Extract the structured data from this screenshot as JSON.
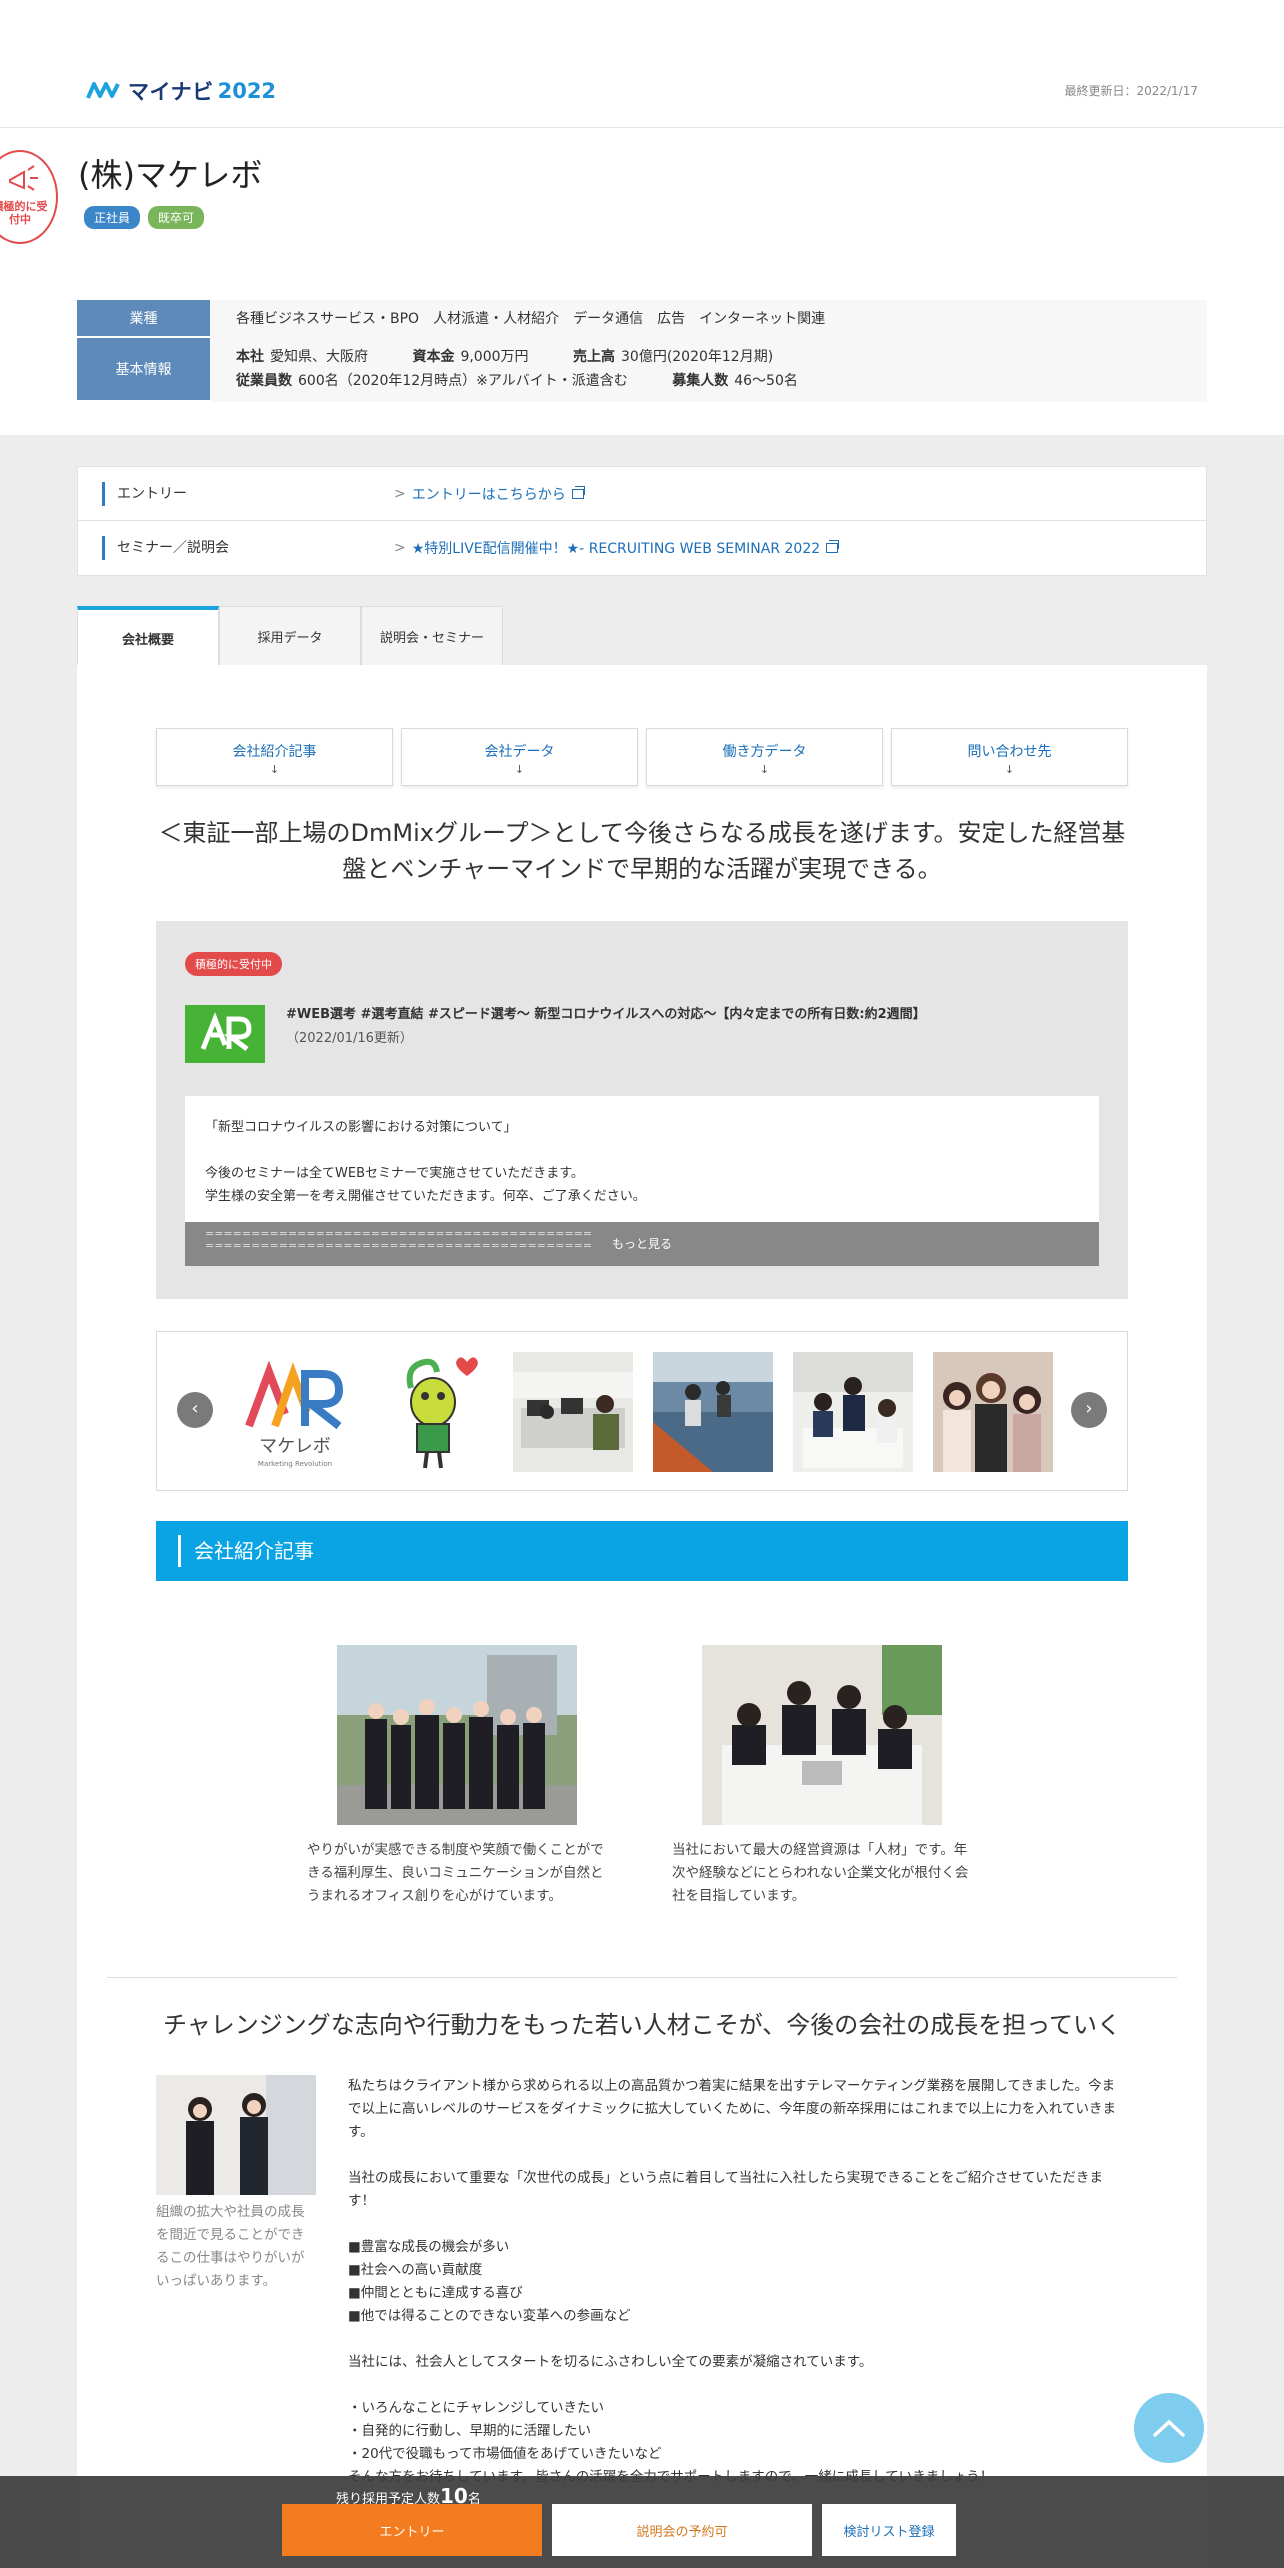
{
  "header": {
    "brand": "マイナビ",
    "year": "2022",
    "updated": "最終更新日：2022/1/17"
  },
  "company": {
    "stamp": "積極的に受付中",
    "name": "(株)マケレボ",
    "tags": [
      "正社員",
      "既卒可"
    ]
  },
  "info": {
    "industry_label": "業種",
    "industries": "各種ビジネスサービス・BPO　人材派遣・人材紹介　データ通信　広告　インターネット関連",
    "basic_label": "基本情報",
    "hq_label": "本社",
    "hq": "愛知県、大阪府",
    "capital_label": "資本金",
    "capital": "9,000万円",
    "sales_label": "売上高",
    "sales": "30億円(2020年12月期)",
    "employees_label": "従業員数",
    "employees": "600名（2020年12月時点）※アルバイト・派遣含む",
    "recruit_label": "募集人数",
    "recruit": "46～50名"
  },
  "links": {
    "entry_label": "エントリー",
    "entry_link": "エントリーはこちらから",
    "seminar_label": "セミナー／説明会",
    "seminar_link": "★特別LIVE配信開催中！★- RECRUITING WEB SEMINAR 2022"
  },
  "tabs": [
    "会社概要",
    "採用データ",
    "説明会・セミナー"
  ],
  "subnav": [
    "会社紹介記事",
    "会社データ",
    "働き方データ",
    "問い合わせ先"
  ],
  "subnav_arrow": "↓",
  "catch": "＜東証一部上場のDmMixグループ＞として今後さらなる成長を遂げます。安定した経営基盤とベンチャーマインドで早期的な活躍が実現できる。",
  "notice": {
    "badge": "積極的に受付中",
    "title": "#WEB選考 #選考直結 #スピード選考～ 新型コロナウイルスへの対応～【内々定までの所有日数:約2週間】",
    "updated": "（2022/01/16更新）",
    "line1": "「新型コロナウイルスの影響における対策について」",
    "line2": "今後のセミナーは全てWEBセミナーで実施させていただきます。",
    "line3": "学生様の安全第一を考え開催させていただきます。何卒、ご了承ください。",
    "eq1": "==========================================",
    "eq2": "==========================================",
    "more": "もっと見る"
  },
  "carousel": {
    "prev": "‹",
    "next": "›",
    "logo_text": "マケレボ",
    "logo_sub": "Marketing Revolution"
  },
  "section_title": "会社紹介記事",
  "articles": [
    {
      "caption": "やりがいが実感できる制度や笑顔で働くことができる福利厚生、良いコミュニケーションが自然とうまれるオフィス創りを心がけています。"
    },
    {
      "caption": "当社において最大の経営資源は「人材」です。年次や経験などにとらわれない企業文化が根付く会社を目指しています。"
    }
  ],
  "head2": "チャレンジングな志向や行動力をもった若い人材こそが、今後の会社の成長を担っていく",
  "side_caption": "組織の拡大や社員の成長を間近で見ることができるこの仕事はやりがいがいっぱいあります。",
  "body": {
    "p1": "私たちはクライアント様から求められる以上の高品質かつ着実に結果を出すテレマーケティング業務を展開してきました。今まで以上に高いレベルのサービスをダイナミックに拡大していくために、今年度の新卒採用にはこれまで以上に力を入れていきます。",
    "p2": "当社の成長において重要な「次世代の成長」という点に着目して当社に入社したら実現できることをご紹介させていただきます！",
    "l1": "■豊富な成長の機会が多い",
    "l2": "■社会への高い貢献度",
    "l3": "■仲間とともに達成する喜び",
    "l4": "■他では得ることのできない変革への参画など",
    "p3": "当社には、社会人としてスタートを切るにふさわしい全ての要素が凝縮されています。",
    "b1": "・いろんなことにチャレンジしていきたい",
    "b2": "・自発的に行動し、早期的に活躍したい",
    "b3": "・20代で役職もって市場価値をあげていきたいなど",
    "p4": "そんな方をお待ちしています。皆さんの活躍を全力でサポートしますので、一緒に成長していきましょう！"
  },
  "footer": {
    "count_prefix": "残り採用予定人数",
    "count": "10",
    "count_suffix": "名",
    "entry": "エントリー",
    "seminar": "説明会の予約可",
    "list": "検討リスト登録"
  },
  "colors": {
    "accent": "#0aa3e3",
    "label_bg": "#5d8ab8",
    "entry_orange": "#f47c20",
    "stamp_red": "#e34b4b"
  }
}
